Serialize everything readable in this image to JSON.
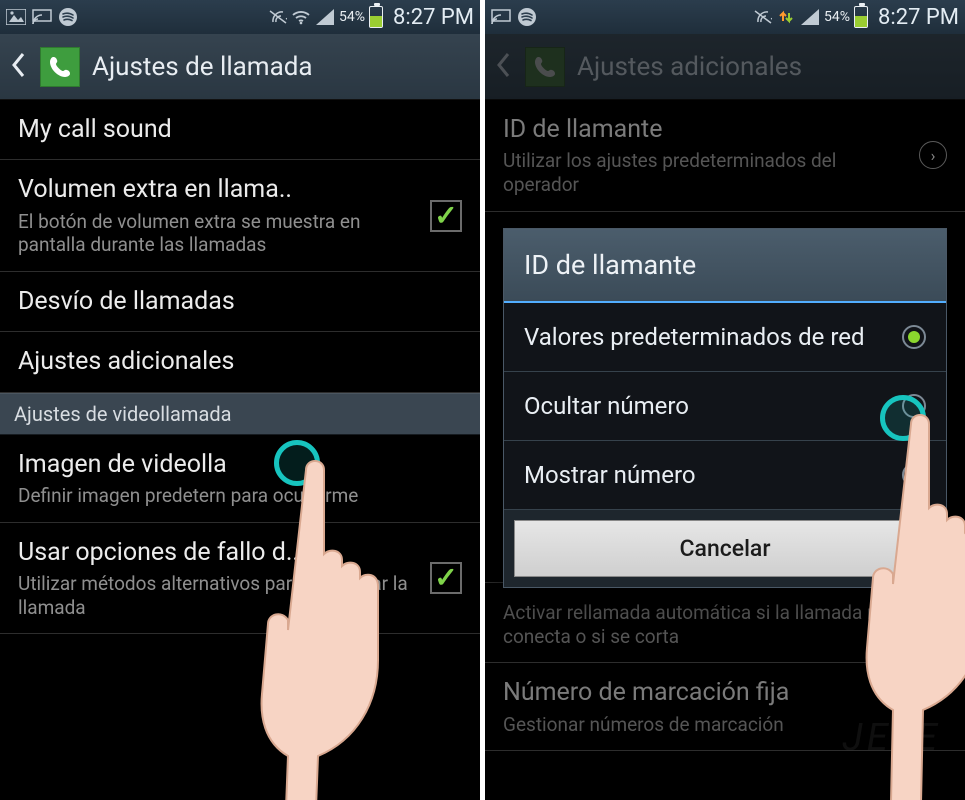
{
  "status": {
    "battery_pct": "54%",
    "clock": "8:27 PM"
  },
  "screen1": {
    "title": "Ajustes de llamada",
    "items": {
      "sound": {
        "title": "My call sound"
      },
      "extra_vol": {
        "title": "Volumen extra en llama..",
        "sub": "El botón de volumen extra se muestra en pantalla durante las llamadas"
      },
      "forward": {
        "title": "Desvío de llamadas"
      },
      "additional": {
        "title": "Ajustes adicionales"
      },
      "section_video": "Ajustes de videollamada",
      "video_img": {
        "title": "Imagen de videolla",
        "sub": "Definir imagen predetern               para ocultarme"
      },
      "fallback": {
        "title": "Usar opciones de fallo d..",
        "sub": "Utilizar métodos alternativos para reintentar la llamada"
      }
    }
  },
  "screen2": {
    "title": "Ajustes adicionales",
    "bg_items": {
      "callerid": {
        "title": "ID de llamante",
        "sub": "Utilizar los ajustes predeterminados del operador"
      },
      "autoredial": {
        "sub": "Activar rellamada automática si la llamada no se conecta o si se corta"
      },
      "fdn": {
        "title": "Número de marcación fija",
        "sub": "Gestionar números de marcación"
      }
    },
    "dialog": {
      "header": "ID de llamante",
      "opt1": "Valores predeterminados de red",
      "opt2": "Ocultar número",
      "opt3": "Mostrar número",
      "cancel": "Cancelar"
    }
  },
  "watermark": "JEFE"
}
